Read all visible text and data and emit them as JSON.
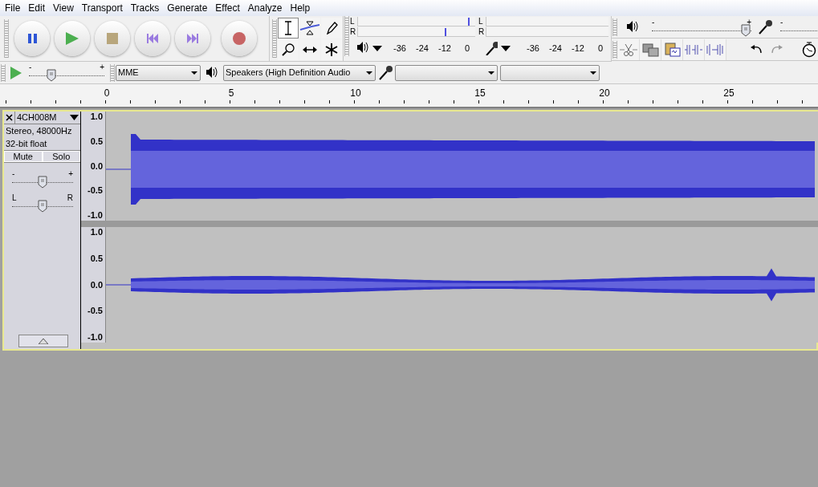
{
  "menu": [
    "File",
    "Edit",
    "View",
    "Transport",
    "Tracks",
    "Generate",
    "Effect",
    "Analyze",
    "Help"
  ],
  "meter_toolbar": {
    "playback": {
      "channels": [
        {
          "label": "L",
          "level": 0.94
        },
        {
          "label": "R",
          "level": 0.74
        }
      ],
      "scale": [
        "-36",
        "-24",
        "-12",
        "0"
      ]
    },
    "recording": {
      "channels": [
        {
          "label": "L"
        },
        {
          "label": "R"
        }
      ],
      "scale": [
        "-36",
        "-24",
        "-12",
        "0"
      ]
    }
  },
  "mixer_toolbar": {
    "output_volume": {
      "min_label": "-",
      "max_label": "+",
      "level": 0.94
    },
    "input_volume": {
      "min_label": "-"
    }
  },
  "play_at_speed": {
    "min_label": "-",
    "max_label": "+",
    "level": 0.3
  },
  "device_toolbar": {
    "host": "MME",
    "output_device": "Speakers (High Definition Audio"
  },
  "ruler": {
    "ticks": [
      "0",
      "5",
      "10",
      "15",
      "20",
      "25"
    ]
  },
  "track": {
    "name": "4CH008M",
    "info": [
      "Stereo, 48000Hz",
      "32-bit float"
    ],
    "buttons": [
      {
        "label": "Mute",
        "selected": false
      },
      {
        "label": "Solo",
        "selected": false
      }
    ],
    "gain": {
      "min_label": "-",
      "max_label": "+",
      "level": 0.5
    },
    "pan": {
      "min_label": "L",
      "max_label": "R",
      "level": 0.5
    },
    "channels": [
      {
        "scale": [
          "1.0",
          "0.5",
          "0.0",
          "-0.5",
          "-1.0"
        ]
      },
      {
        "scale": [
          "1.0",
          "0.5",
          "0.0",
          "-0.5",
          "-1.0"
        ]
      }
    ]
  }
}
